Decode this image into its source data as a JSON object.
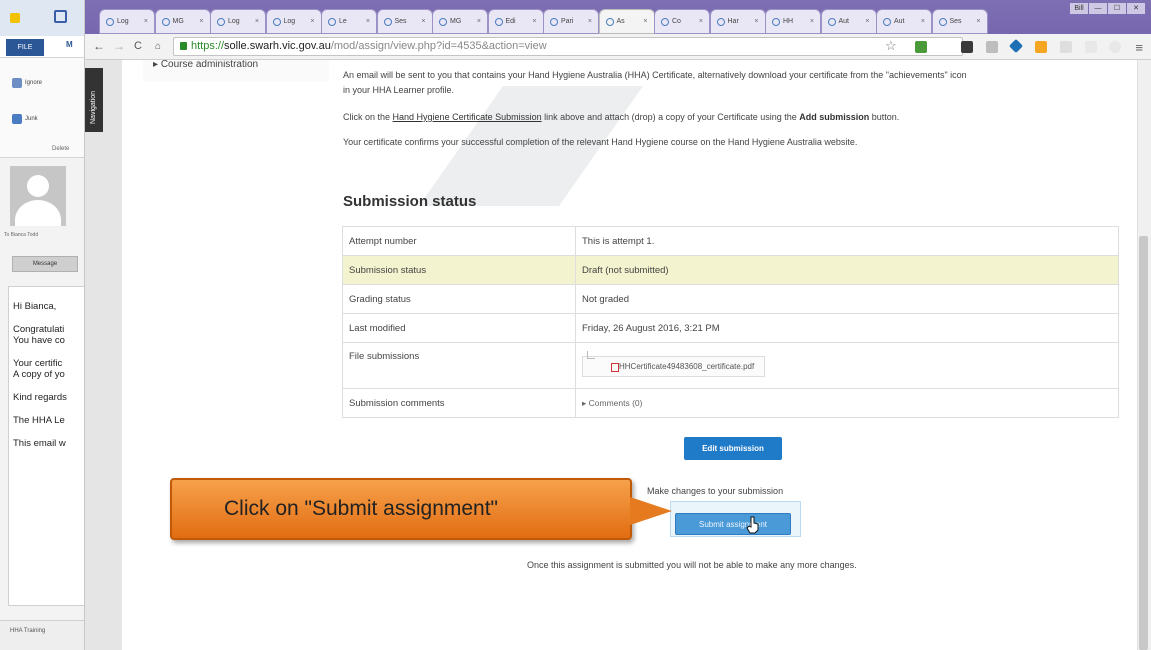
{
  "outlook": {
    "file_tab": "FILE",
    "m_tab": "M",
    "ignore_label": "Ignore",
    "junk_label": "Junk",
    "delete_label": "Delete",
    "sender": "To  Bianca Todd",
    "message_button": "Message",
    "body_lines": [
      "Hi Bianca,",
      "Congratulati",
      "You have co",
      "Your certific",
      "A copy of yo",
      "Kind regards",
      "The HHA Le",
      "This email w"
    ],
    "footer": "HHA Training"
  },
  "browser": {
    "tabs": [
      "Log",
      "MG",
      "Log",
      "Log",
      "Le",
      "Ses",
      "MG",
      "Edi",
      "Pari",
      "As",
      "Co",
      "Har",
      "HH",
      "Aut",
      "Aut",
      "Ses"
    ],
    "active_tab_index": 9,
    "tab_close": "×",
    "window_controls": [
      "Bill",
      "—",
      "☐",
      "✕"
    ],
    "url_scheme": "https://",
    "url_host": "solle.swarh.vic.gov.au",
    "url_path": "/mod/assign/view.php?id=4535&action=view"
  },
  "page": {
    "navigation_label": "Navigation",
    "course_admin": "Course administration",
    "para1_line1": "An email will be sent to you that contains your Hand Hygiene Australia (HHA) Certificate, alternatively download your certificate from the \"achievements\" icon",
    "para1_line2": "in your HHA Learner profile.",
    "para2_pre": "Click on the ",
    "para2_link": "Hand Hygiene Certificate Submission",
    "para2_mid": " link above and attach (drop) a copy of your Certificate using the ",
    "para2_bold": "Add submission",
    "para2_post": " button.",
    "para3": "Your certificate confirms your successful completion of the relevant Hand Hygiene course on the Hand Hygiene Australia website.",
    "submission_heading": "Submission status",
    "rows": [
      {
        "label": "Attempt number",
        "value": "This is attempt 1."
      },
      {
        "label": "Submission status",
        "value": "Draft (not submitted)"
      },
      {
        "label": "Grading status",
        "value": "Not graded"
      },
      {
        "label": "Last modified",
        "value": "Friday, 26 August 2016, 3:21 PM"
      },
      {
        "label": "File submissions",
        "value": "HHCertificate49483608_certificate.pdf"
      },
      {
        "label": "Submission comments",
        "value": "Comments (0)"
      }
    ],
    "edit_submission": "Edit submission",
    "make_changes": "Make changes to your submission",
    "submit_assignment": "Submit assignment",
    "once_note": "Once this assignment is submitted you will not be able to make any more changes."
  },
  "callout": {
    "text": "Click on \"Submit assignment\""
  },
  "colors": {
    "primary_button": "#1f7ac8",
    "draft_row": "#f3f3cf",
    "callout_orange": "#f08a2c",
    "tabstrip": "#7667b0"
  },
  "icons": [
    "lock-icon",
    "star-icon",
    "menu-icon",
    "pdf-icon",
    "cursor-icon",
    "avatar-icon"
  ]
}
